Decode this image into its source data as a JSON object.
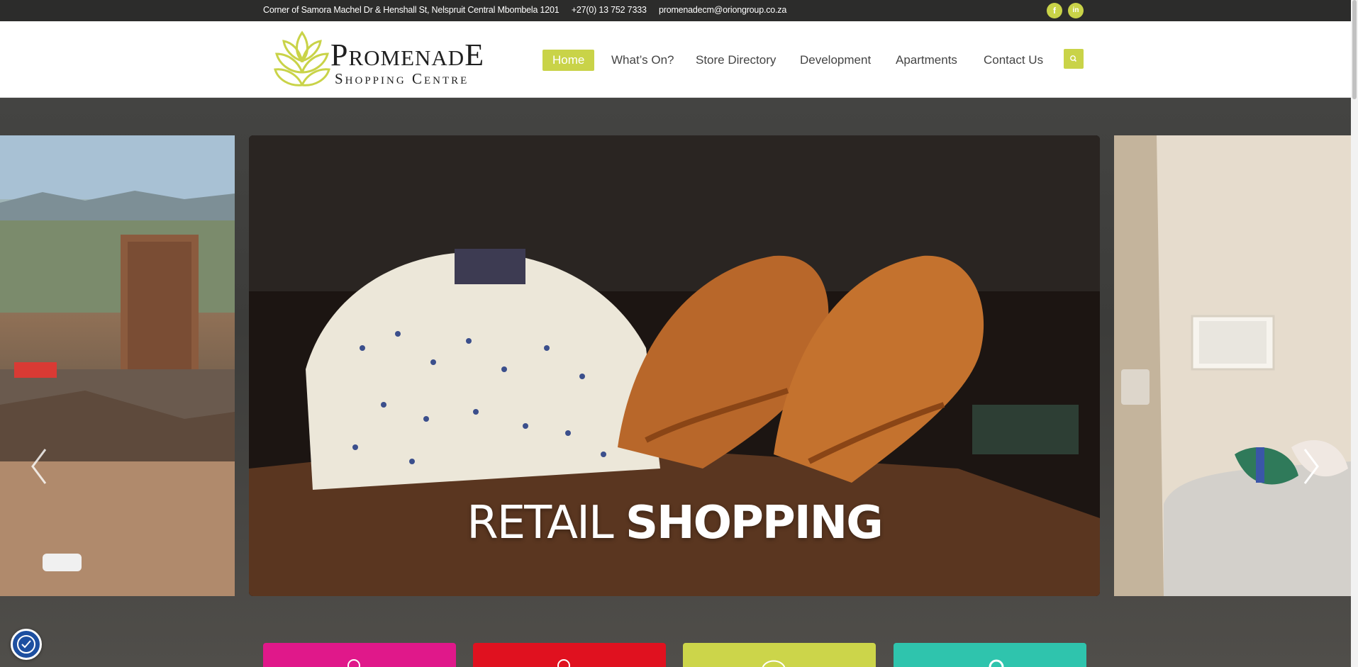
{
  "topbar": {
    "address": "Corner of Samora Machel Dr & Henshall St, Nelspruit Central Mbombela 1201",
    "phone": "+27(0) 13 752 7333",
    "email": "promenadecm@oriongroup.co.za",
    "social": [
      {
        "icon": "facebook-icon",
        "glyph": "f"
      },
      {
        "icon": "linkedin-icon",
        "glyph": "in"
      }
    ]
  },
  "header": {
    "logo_main": "PromenadE",
    "logo_sub": "Shopping Centre",
    "nav": [
      {
        "label": "Home",
        "active": true
      },
      {
        "label": "What’s On?"
      },
      {
        "label": "Store Directory"
      },
      {
        "label": "Development"
      },
      {
        "label": "Apartments"
      },
      {
        "label": "Contact Us"
      }
    ],
    "search_icon": "search-icon"
  },
  "slider": {
    "caption_light": "RETAIL",
    "caption_bold": "SHOPPING",
    "prev_icon": "chevron-left-icon",
    "next_icon": "chevron-right-icon"
  },
  "tiles": [
    {
      "color": "#e0188a"
    },
    {
      "color": "#e0111f"
    },
    {
      "color": "#ccd54a"
    },
    {
      "color": "#2fc4ad"
    }
  ],
  "colors": {
    "accent": "#c9d348",
    "topbar": "#2c2c2b"
  }
}
